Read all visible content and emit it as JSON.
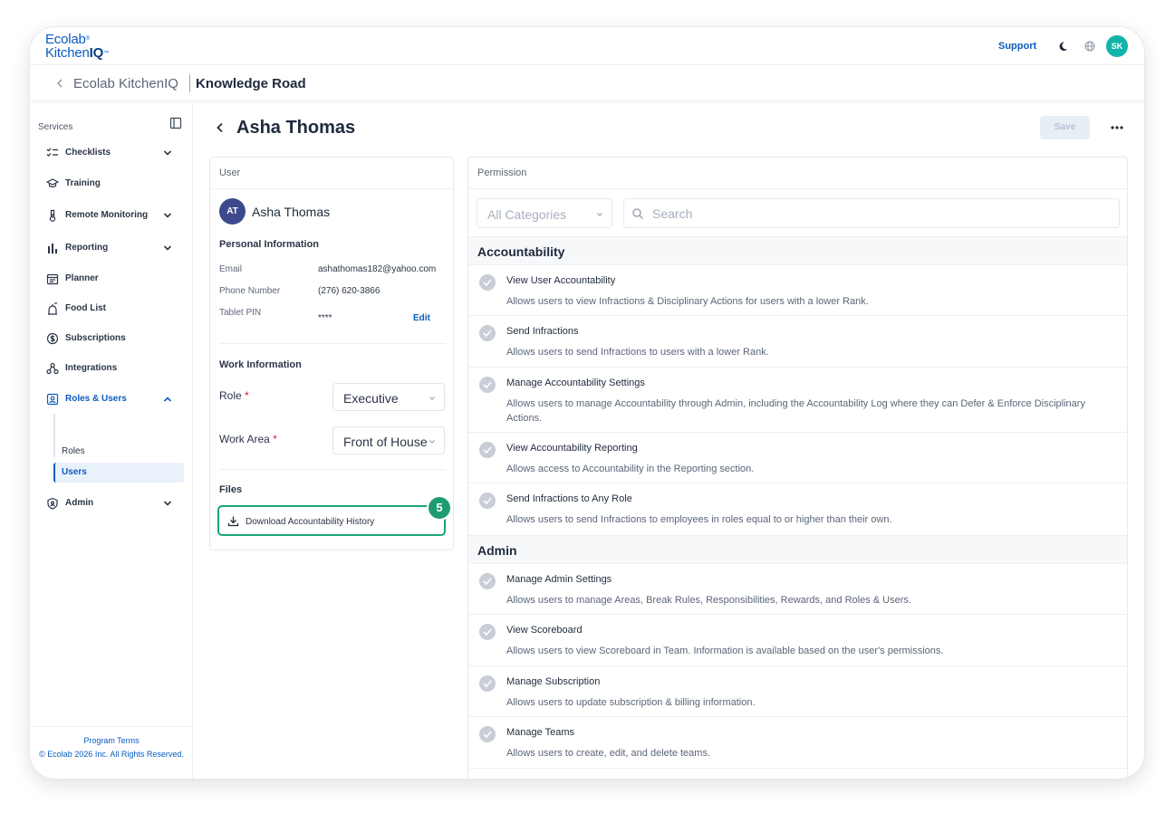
{
  "brand": {
    "line1": "Ecolab",
    "line2_a": "Kitchen",
    "line2_b": "IQ"
  },
  "topbar": {
    "support": "Support",
    "user_initials": "SK"
  },
  "breadcrumb": {
    "org": "Ecolab KitchenIQ",
    "location": "Knowledge Road"
  },
  "sidebar": {
    "section_label": "Services",
    "items": [
      {
        "label": "Checklists",
        "icon": "checklist-icon",
        "has_chevron": true
      },
      {
        "label": "Training",
        "icon": "graduation-cap-icon",
        "has_chevron": false
      },
      {
        "label": "Remote Monitoring",
        "icon": "thermometer-icon",
        "has_chevron": true
      },
      {
        "label": "Reporting",
        "icon": "bar-chart-icon",
        "has_chevron": true
      },
      {
        "label": "Planner",
        "icon": "calendar-icon",
        "has_chevron": false
      },
      {
        "label": "Food List",
        "icon": "food-list-icon",
        "has_chevron": false
      },
      {
        "label": "Subscriptions",
        "icon": "dollar-icon",
        "has_chevron": false
      },
      {
        "label": "Integrations",
        "icon": "integrations-icon",
        "has_chevron": false
      },
      {
        "label": "Roles & Users",
        "icon": "id-badge-icon",
        "has_chevron": true,
        "expanded": true
      },
      {
        "label": "Admin",
        "icon": "shield-icon",
        "has_chevron": true
      }
    ],
    "sub_items": [
      {
        "label": "Roles"
      },
      {
        "label": "Users",
        "active": true
      }
    ],
    "footer": {
      "terms": "Program Terms",
      "copyright": "© Ecolab 2026 Inc. All Rights Reserved."
    }
  },
  "page": {
    "title": "Asha Thomas",
    "save_label": "Save"
  },
  "user_card": {
    "header": "User",
    "initials": "AT",
    "name": "Asha Thomas",
    "personal_title": "Personal Information",
    "email_label": "Email",
    "email": "ashathomas182@yahoo.com",
    "phone_label": "Phone Number",
    "phone": "(276) 620-3866",
    "pin_label": "Tablet PIN",
    "pin": "****",
    "edit_label": "Edit",
    "work_title": "Work Information",
    "role_label": "Role",
    "role_value": "Executive",
    "area_label": "Work Area",
    "area_value": "Front of House",
    "required_mark": "*",
    "files_title": "Files",
    "download_label": "Download Accountability History",
    "step_badge": "5"
  },
  "permissions": {
    "header": "Permission",
    "category_placeholder": "All Categories",
    "search_placeholder": "Search",
    "groups": [
      {
        "name": "Accountability",
        "items": [
          {
            "title": "View User Accountability",
            "desc": "Allows users to view Infractions & Disciplinary Actions for users with a lower Rank."
          },
          {
            "title": "Send Infractions",
            "desc": "Allows users to send Infractions to users with a lower Rank."
          },
          {
            "title": "Manage Accountability Settings",
            "desc": "Allows users to manage Accountability through Admin, including the Accountability Log where they can Defer & Enforce Disciplinary Actions."
          },
          {
            "title": "View Accountability Reporting",
            "desc": "Allows access to Accountability in the Reporting section."
          },
          {
            "title": "Send Infractions to Any Role",
            "desc": "Allows users to send Infractions to employees in roles equal to or higher than their own."
          }
        ]
      },
      {
        "name": "Admin",
        "items": [
          {
            "title": "Manage Admin Settings",
            "desc": "Allows users to manage Areas, Break Rules, Responsibilities, Rewards, and Roles & Users."
          },
          {
            "title": "View Scoreboard",
            "desc": "Allows users to view Scoreboard in Team. Information is available based on the user's permissions."
          },
          {
            "title": "Manage Subscription",
            "desc": "Allows users to update subscription & billing information."
          },
          {
            "title": "Manage Teams",
            "desc": "Allows users to create, edit, and delete teams."
          }
        ]
      }
    ]
  },
  "colors": {
    "accent": "#0a5cc0",
    "brand_teal": "#12b3a8",
    "highlight_green": "#1aa37a",
    "required": "#d3202f"
  }
}
